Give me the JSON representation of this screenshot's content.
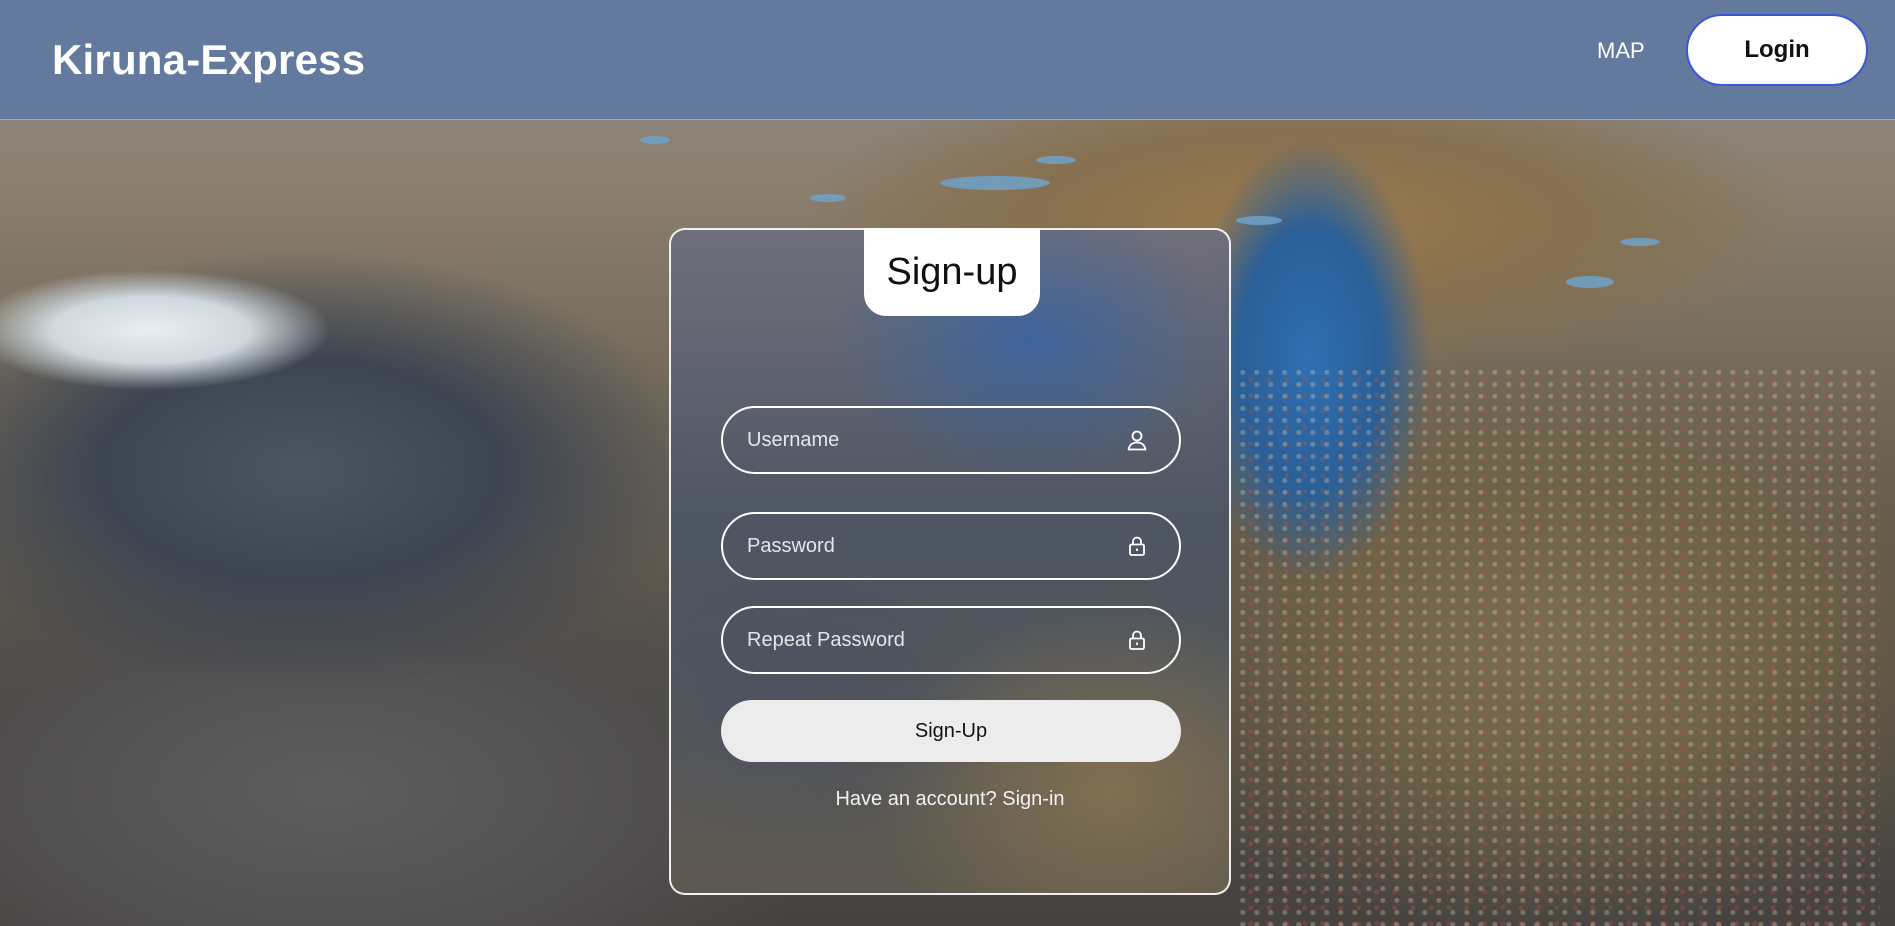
{
  "header": {
    "brand": "Kiruna-Express",
    "nav_map": "MAP",
    "login_label": "Login"
  },
  "signup_card": {
    "title": "Sign-up",
    "username_placeholder": "Username",
    "password_placeholder": "Password",
    "repeat_password_placeholder": "Repeat Password",
    "submit_label": "Sign-Up",
    "account_prompt": "Have an account?",
    "signin_link": "Sign-in"
  },
  "icons": {
    "username": "user-icon",
    "password": "lock-icon",
    "repeat_password": "lock-icon"
  }
}
